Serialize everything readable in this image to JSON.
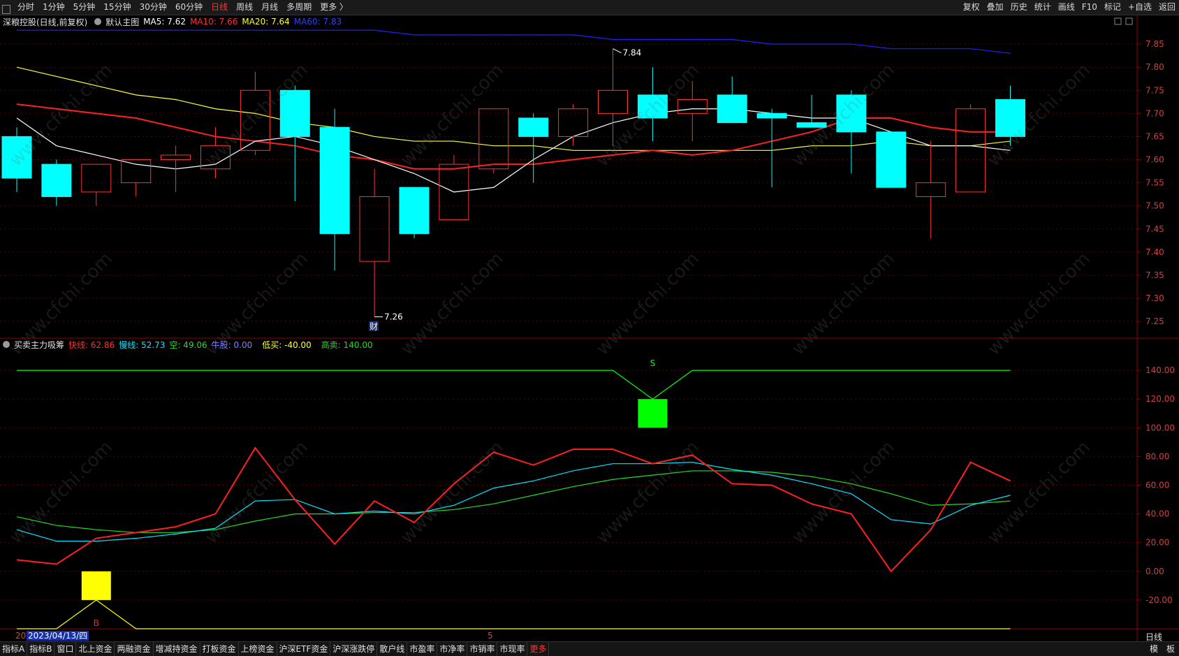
{
  "topbar": {
    "tabs": [
      "分时",
      "1分钟",
      "5分钟",
      "15分钟",
      "30分钟",
      "60分钟",
      "日线",
      "周线",
      "月线",
      "多周期",
      "更多 〉"
    ],
    "active_tab": "日线",
    "right": [
      "复权",
      "叠加",
      "历史",
      "统计",
      "画线",
      "F10",
      "标记",
      "+自选",
      "返回"
    ]
  },
  "main_info": {
    "title": "深粮控股(日线,前复权)",
    "template": "默认主图",
    "ma5": "MA5: 7.62",
    "ma10": "MA10: 7.66",
    "ma20": "MA20: 7.64",
    "ma60": "MA60: 7.83"
  },
  "indicator_info": {
    "name": "买卖主力吸筹",
    "fast": "快线: 62.86",
    "slow": "慢线: 52.73",
    "empty": "空: 49.06",
    "bull": "牛股: 0.00",
    "low_buy": "低买: -40.00",
    "high_sell": "高卖: 140.00"
  },
  "colors": {
    "up": "#ff3333",
    "down": "#00ffff",
    "ma5": "#ffffff",
    "ma10": "#ff2020",
    "ma20": "#ffff33",
    "ma60": "#2020ff",
    "fast": "#ff2020",
    "slow": "#00e5ff",
    "empty": "#22dd22",
    "buy_marker": "#ffff00",
    "sell_marker": "#00ff00"
  },
  "chart_data": [
    {
      "type": "candlestick",
      "title": "深粮控股(日线,前复权)",
      "ylim": [
        7.22,
        7.9
      ],
      "yticks": [
        "7.85",
        "7.80",
        "7.75",
        "7.70",
        "7.65",
        "7.60",
        "7.55",
        "7.50",
        "7.45",
        "7.40",
        "7.35",
        "7.30",
        "7.25"
      ],
      "candles": [
        {
          "o": 7.65,
          "h": 7.67,
          "l": 7.53,
          "c": 7.56
        },
        {
          "o": 7.59,
          "h": 7.6,
          "l": 7.5,
          "c": 7.52
        },
        {
          "o": 7.53,
          "h": 7.59,
          "l": 7.5,
          "c": 7.59
        },
        {
          "o": 7.55,
          "h": 7.6,
          "l": 7.52,
          "c": 7.6
        },
        {
          "o": 7.6,
          "h": 7.63,
          "l": 7.53,
          "c": 7.61
        },
        {
          "o": 7.58,
          "h": 7.67,
          "l": 7.56,
          "c": 7.63
        },
        {
          "o": 7.62,
          "h": 7.79,
          "l": 7.61,
          "c": 7.75
        },
        {
          "o": 7.75,
          "h": 7.76,
          "l": 7.51,
          "c": 7.65
        },
        {
          "o": 7.67,
          "h": 7.71,
          "l": 7.36,
          "c": 7.44
        },
        {
          "o": 7.38,
          "h": 7.58,
          "l": 7.26,
          "c": 7.52
        },
        {
          "o": 7.54,
          "h": 7.54,
          "l": 7.43,
          "c": 7.44
        },
        {
          "o": 7.47,
          "h": 7.61,
          "l": 7.47,
          "c": 7.59
        },
        {
          "o": 7.58,
          "h": 7.71,
          "l": 7.57,
          "c": 7.71
        },
        {
          "o": 7.69,
          "h": 7.7,
          "l": 7.55,
          "c": 7.65
        },
        {
          "o": 7.65,
          "h": 7.72,
          "l": 7.63,
          "c": 7.71
        },
        {
          "o": 7.7,
          "h": 7.84,
          "l": 7.63,
          "c": 7.75
        },
        {
          "o": 7.74,
          "h": 7.8,
          "l": 7.64,
          "c": 7.69
        },
        {
          "o": 7.7,
          "h": 7.77,
          "l": 7.64,
          "c": 7.73
        },
        {
          "o": 7.74,
          "h": 7.78,
          "l": 7.68,
          "c": 7.68
        },
        {
          "o": 7.7,
          "h": 7.71,
          "l": 7.54,
          "c": 7.69
        },
        {
          "o": 7.68,
          "h": 7.74,
          "l": 7.67,
          "c": 7.67
        },
        {
          "o": 7.74,
          "h": 7.75,
          "l": 7.57,
          "c": 7.66
        },
        {
          "o": 7.66,
          "h": 7.66,
          "l": 7.54,
          "c": 7.54
        },
        {
          "o": 7.52,
          "h": 7.64,
          "l": 7.43,
          "c": 7.55
        },
        {
          "o": 7.53,
          "h": 7.72,
          "l": 7.53,
          "c": 7.71
        },
        {
          "o": 7.73,
          "h": 7.76,
          "l": 7.63,
          "c": 7.65
        }
      ],
      "ma5": [
        7.69,
        7.63,
        7.61,
        7.59,
        7.58,
        7.59,
        7.64,
        7.65,
        7.63,
        7.6,
        7.57,
        7.53,
        7.54,
        7.6,
        7.65,
        7.68,
        7.7,
        7.71,
        7.71,
        7.7,
        7.69,
        7.69,
        7.66,
        7.63,
        7.63,
        7.62
      ],
      "ma10": [
        7.72,
        7.71,
        7.7,
        7.69,
        7.67,
        7.65,
        7.64,
        7.63,
        7.61,
        7.6,
        7.58,
        7.58,
        7.59,
        7.59,
        7.6,
        7.61,
        7.62,
        7.61,
        7.62,
        7.64,
        7.66,
        7.69,
        7.69,
        7.67,
        7.66,
        7.66
      ],
      "ma20": [
        7.8,
        7.78,
        7.76,
        7.74,
        7.73,
        7.71,
        7.7,
        7.68,
        7.67,
        7.65,
        7.64,
        7.64,
        7.63,
        7.63,
        7.62,
        7.62,
        7.62,
        7.62,
        7.62,
        7.62,
        7.63,
        7.63,
        7.64,
        7.63,
        7.63,
        7.64
      ],
      "ma60": [
        7.88,
        7.88,
        7.88,
        7.88,
        7.88,
        7.88,
        7.88,
        7.88,
        7.88,
        7.88,
        7.87,
        7.87,
        7.87,
        7.87,
        7.87,
        7.86,
        7.86,
        7.86,
        7.86,
        7.85,
        7.85,
        7.85,
        7.84,
        7.84,
        7.84,
        7.83
      ],
      "annotations": [
        {
          "label": "7.84",
          "index": 15
        },
        {
          "label": "7.26",
          "index": 9
        },
        {
          "label": "财",
          "index": 9
        }
      ]
    },
    {
      "type": "line",
      "title": "买卖主力吸筹",
      "ylim": [
        -40,
        160
      ],
      "yticks": [
        "140.00",
        "120.00",
        "100.00",
        "80.00",
        "60.00",
        "40.00",
        "20.00",
        "0.00",
        "-20.00"
      ],
      "series": [
        {
          "name": "快线",
          "values": [
            8,
            5,
            23,
            27,
            31,
            40,
            86,
            50,
            19,
            49,
            34,
            61,
            83,
            74,
            85,
            85,
            75,
            81,
            61,
            60,
            47,
            40,
            0,
            29,
            76,
            63
          ]
        },
        {
          "name": "慢线",
          "values": [
            29,
            21,
            21,
            23,
            26,
            30,
            49,
            50,
            40,
            42,
            40,
            46,
            58,
            63,
            70,
            75,
            75,
            76,
            71,
            67,
            61,
            54,
            36,
            33,
            46,
            53
          ]
        },
        {
          "name": "空",
          "values": [
            38,
            32,
            29,
            27,
            27,
            29,
            35,
            40,
            40,
            41,
            41,
            43,
            47,
            53,
            59,
            64,
            67,
            70,
            70,
            69,
            66,
            61,
            54,
            46,
            47,
            49
          ]
        }
      ],
      "line_high": {
        "name": "高卖",
        "value": 140,
        "dip_index": 16,
        "dip_value": 120
      },
      "line_low": {
        "name": "低买",
        "value": -40,
        "peak_index": 2,
        "peak_value": -20
      },
      "markers": [
        {
          "label": "S",
          "index": 16,
          "from": 100,
          "to": 120
        },
        {
          "label": "B",
          "index": 2,
          "from": -20,
          "to": 0
        }
      ]
    }
  ],
  "cursor_date": "2023/04/13/四",
  "date_prefix": "20",
  "date_mark": "5",
  "period_label": "日线",
  "watermark": "www.cfchi.com",
  "bottombar": {
    "tabs": [
      "指标A",
      "指标B",
      "窗口",
      "北上资金",
      "两融资金",
      "增减持资金",
      "打板资金",
      "上榜资金",
      "沪深ETF资金",
      "沪深涨跌停",
      "散户线",
      "市盈率",
      "市净率",
      "市销率",
      "市现率",
      "更多"
    ],
    "active": "更多",
    "right": [
      "模",
      "板"
    ]
  }
}
